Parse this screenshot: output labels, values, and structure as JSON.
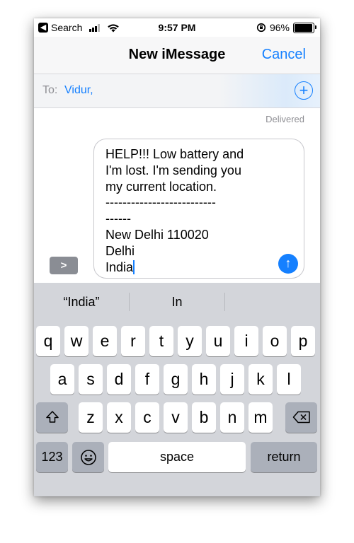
{
  "status_bar": {
    "back_app": "Search",
    "time": "9:57 PM",
    "battery": "96%",
    "battery_level": 0.96
  },
  "nav": {
    "title": "New iMessage",
    "cancel_label": "Cancel"
  },
  "to_field": {
    "label": "To:",
    "recipient": "Vidur,"
  },
  "status_text": "Delivered",
  "compose": {
    "lines": [
      "HELP!!! Low battery and",
      "I'm lost. I'm sending you",
      "my current location.",
      "--------------------------",
      "------",
      "New Delhi 110020",
      "Delhi",
      "India"
    ]
  },
  "predictive": {
    "suggestions": [
      "“India”",
      "In",
      ""
    ]
  },
  "keyboard": {
    "row1": [
      "q",
      "w",
      "e",
      "r",
      "t",
      "y",
      "u",
      "i",
      "o",
      "p"
    ],
    "row2": [
      "a",
      "s",
      "d",
      "f",
      "g",
      "h",
      "j",
      "k",
      "l"
    ],
    "row3": [
      "z",
      "x",
      "c",
      "v",
      "b",
      "n",
      "m"
    ],
    "numbers_label": "123",
    "space_label": "space",
    "return_label": "return"
  },
  "colors": {
    "accent": "#1580ff",
    "keyboard_bg": "#d3d5da",
    "function_key": "#abb0ba"
  }
}
